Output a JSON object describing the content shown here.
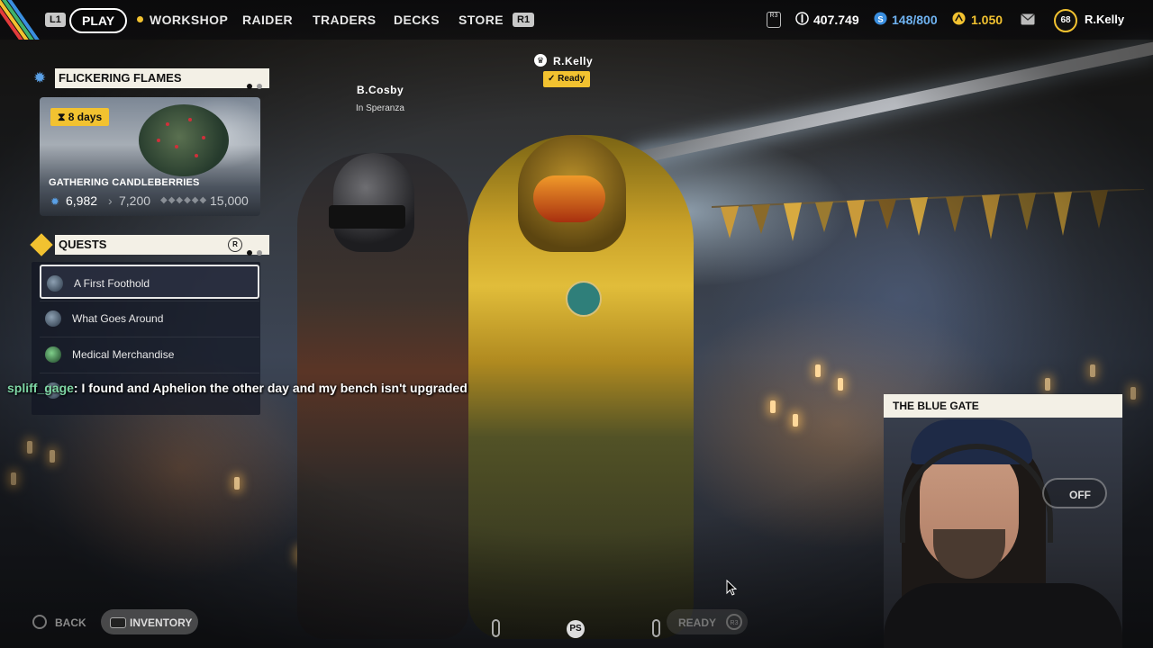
{
  "topbar": {
    "l1_hint": "L1",
    "r1_hint": "R1",
    "r3_hint": "R3",
    "nav": [
      {
        "label": "PLAY",
        "active": true
      },
      {
        "label": "WORKSHOP"
      },
      {
        "label": "RAIDER"
      },
      {
        "label": "TRADERS"
      },
      {
        "label": "DECKS"
      },
      {
        "label": "STORE"
      }
    ],
    "currencies": {
      "coins": "407.749",
      "stash": "148/800",
      "tokens": "1.050"
    },
    "player": {
      "level": "68",
      "name": "R.Kelly"
    }
  },
  "event": {
    "title": "FLICKERING FLAMES",
    "timer": "8  days",
    "name": "GATHERING CANDLEBERRIES",
    "current": "6,982",
    "next": "7,200",
    "max": "15,000"
  },
  "quests": {
    "title": "QUESTS",
    "r_hint": "R",
    "items": [
      {
        "label": "A First Foothold",
        "selected": true
      },
      {
        "label": "What Goes Around"
      },
      {
        "label": "Medical Merchandise"
      }
    ]
  },
  "lobby": {
    "player1": {
      "name": "B.Cosby",
      "status": "In Speranza"
    },
    "player2": {
      "name": "R.Kelly",
      "status": "Ready"
    }
  },
  "chat": {
    "user": "spliff_gage",
    "message": "I found and Aphelion the other day and my bench isn't upgraded"
  },
  "webcam": {
    "title": "THE BLUE GATE",
    "toggle": "OFF"
  },
  "bottombar": {
    "back": "BACK",
    "inventory": "INVENTORY",
    "ready": "READY",
    "r3": "R3"
  },
  "colors": {
    "accent_yellow": "#f2c230",
    "panel_cream": "#f3f0e6",
    "chat_user": "#7ed6a5",
    "gear_blue": "#5aa0e6"
  }
}
